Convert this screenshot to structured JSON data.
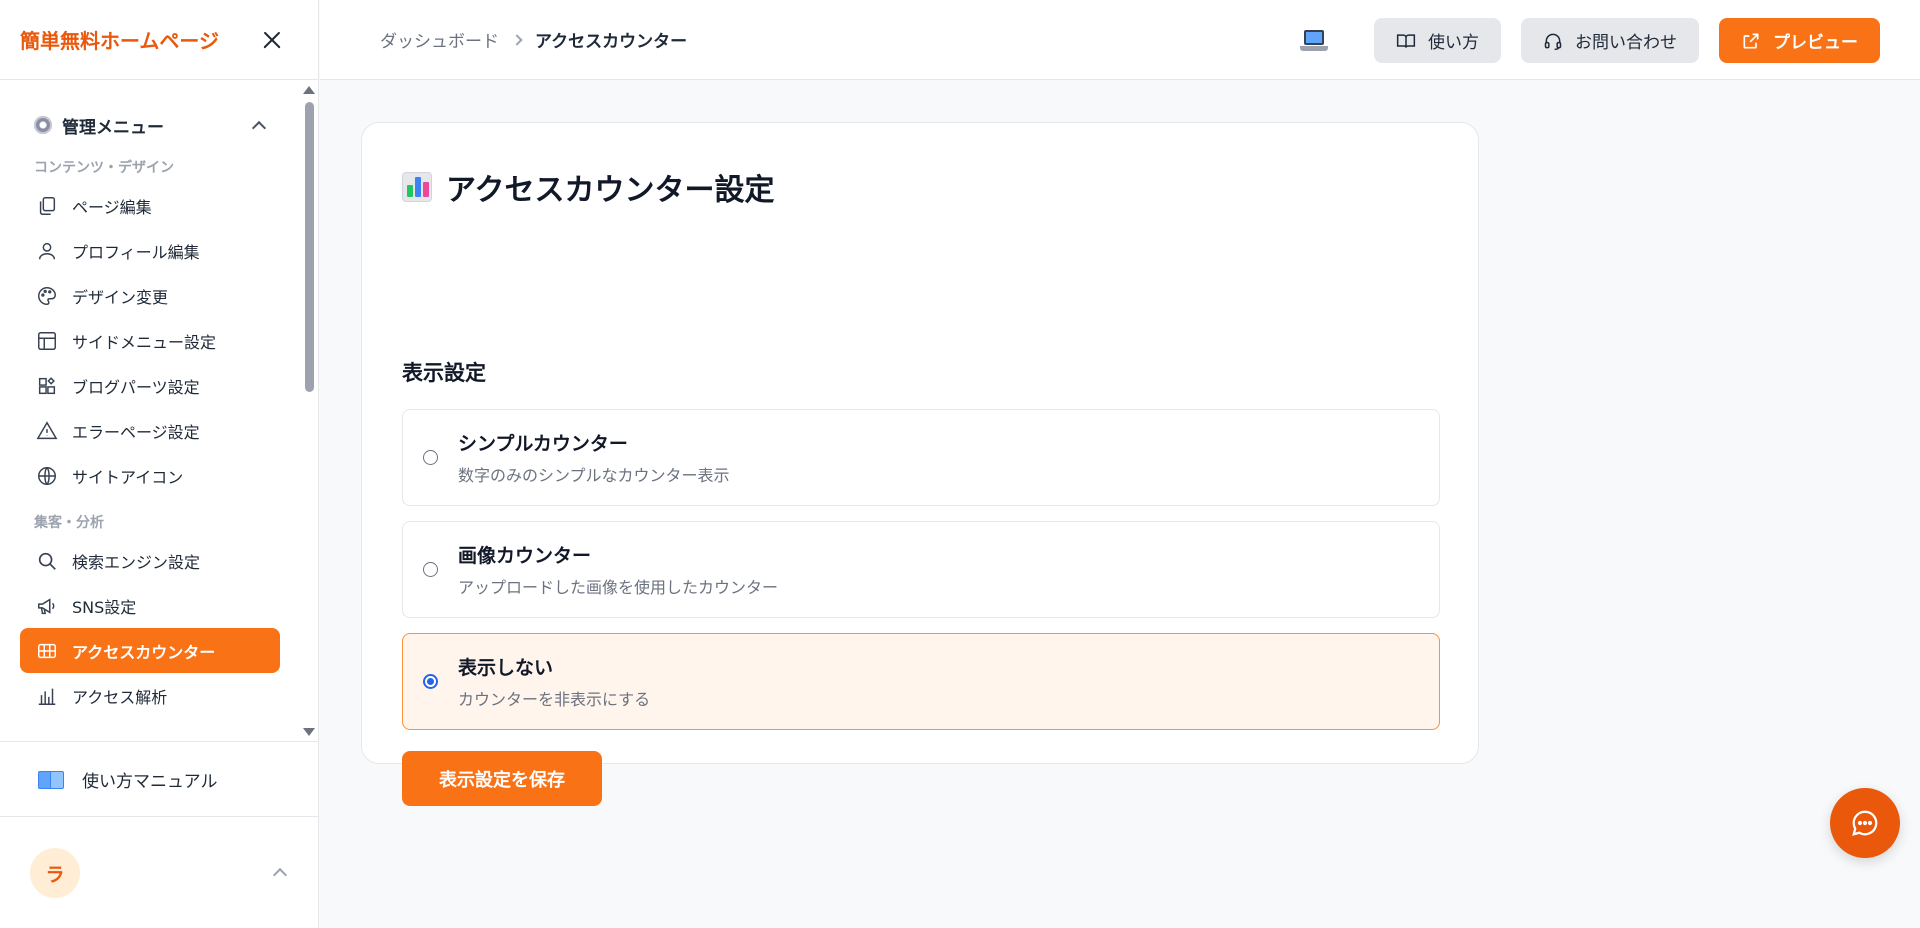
{
  "brand": {
    "title": "簡単無料ホームページ",
    "color": "#ea580c"
  },
  "sidebar": {
    "menu_title": "管理メニュー",
    "sections": [
      {
        "label": "コンテンツ・デザイン",
        "items": [
          {
            "label": "ページ編集",
            "icon": "pages-icon"
          },
          {
            "label": "プロフィール編集",
            "icon": "user-icon"
          },
          {
            "label": "デザイン変更",
            "icon": "palette-icon"
          },
          {
            "label": "サイドメニュー設定",
            "icon": "layout-icon"
          },
          {
            "label": "ブログパーツ設定",
            "icon": "widget-icon"
          },
          {
            "label": "エラーページ設定",
            "icon": "warning-icon"
          },
          {
            "label": "サイトアイコン",
            "icon": "globe-icon"
          }
        ]
      },
      {
        "label": "集客・分析",
        "items": [
          {
            "label": "検索エンジン設定",
            "icon": "search-icon"
          },
          {
            "label": "SNS設定",
            "icon": "megaphone-icon"
          },
          {
            "label": "アクセスカウンター",
            "icon": "grid-icon",
            "active": true
          },
          {
            "label": "アクセス解析",
            "icon": "bar-chart-icon"
          }
        ]
      }
    ],
    "manual_label": "使い方マニュアル",
    "user_initial": "ラ"
  },
  "header": {
    "breadcrumb": {
      "parent": "ダッシュボード",
      "current": "アクセスカウンター"
    },
    "buttons": {
      "howto": "使い方",
      "contact": "お問い合わせ",
      "preview": "プレビュー"
    },
    "accent": "#f97316"
  },
  "main": {
    "title": "アクセスカウンター設定",
    "section_title": "表示設定",
    "options": [
      {
        "title": "シンプルカウンター",
        "desc": "数字のみのシンプルなカウンター表示",
        "selected": false
      },
      {
        "title": "画像カウンター",
        "desc": "アップロードした画像を使用したカウンター",
        "selected": false
      },
      {
        "title": "表示しない",
        "desc": "カウンターを非表示にする",
        "selected": true
      }
    ],
    "save_label": "表示設定を保存"
  }
}
